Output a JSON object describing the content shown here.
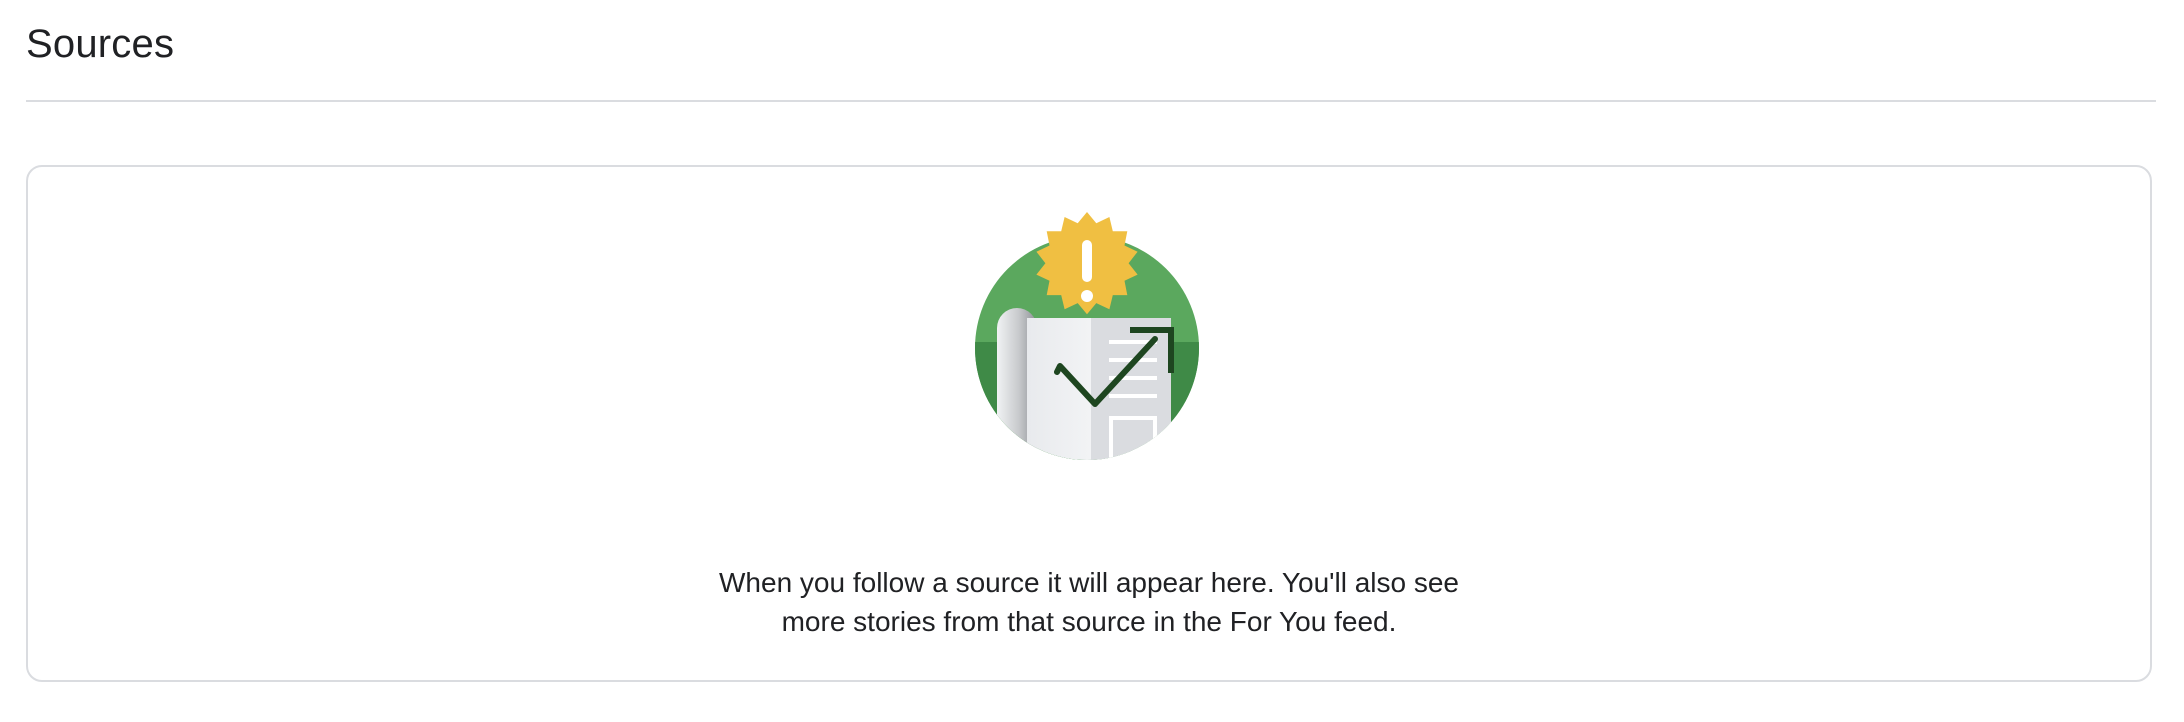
{
  "header": {
    "title": "Sources"
  },
  "empty_state": {
    "illustration_icon": "newspaper-trending-badge-icon",
    "message_line_1": "When you follow a source it will appear here. You'll also see",
    "message_line_2": "more stories from that source in the For You feed."
  },
  "colors": {
    "title_text": "#202124",
    "divider": "#dadce0",
    "badge_yellow": "#f0bf42",
    "circle_green": "#5ba85e",
    "circle_green_dark": "#3f8a47",
    "arrow_dark_green": "#1e4620"
  }
}
